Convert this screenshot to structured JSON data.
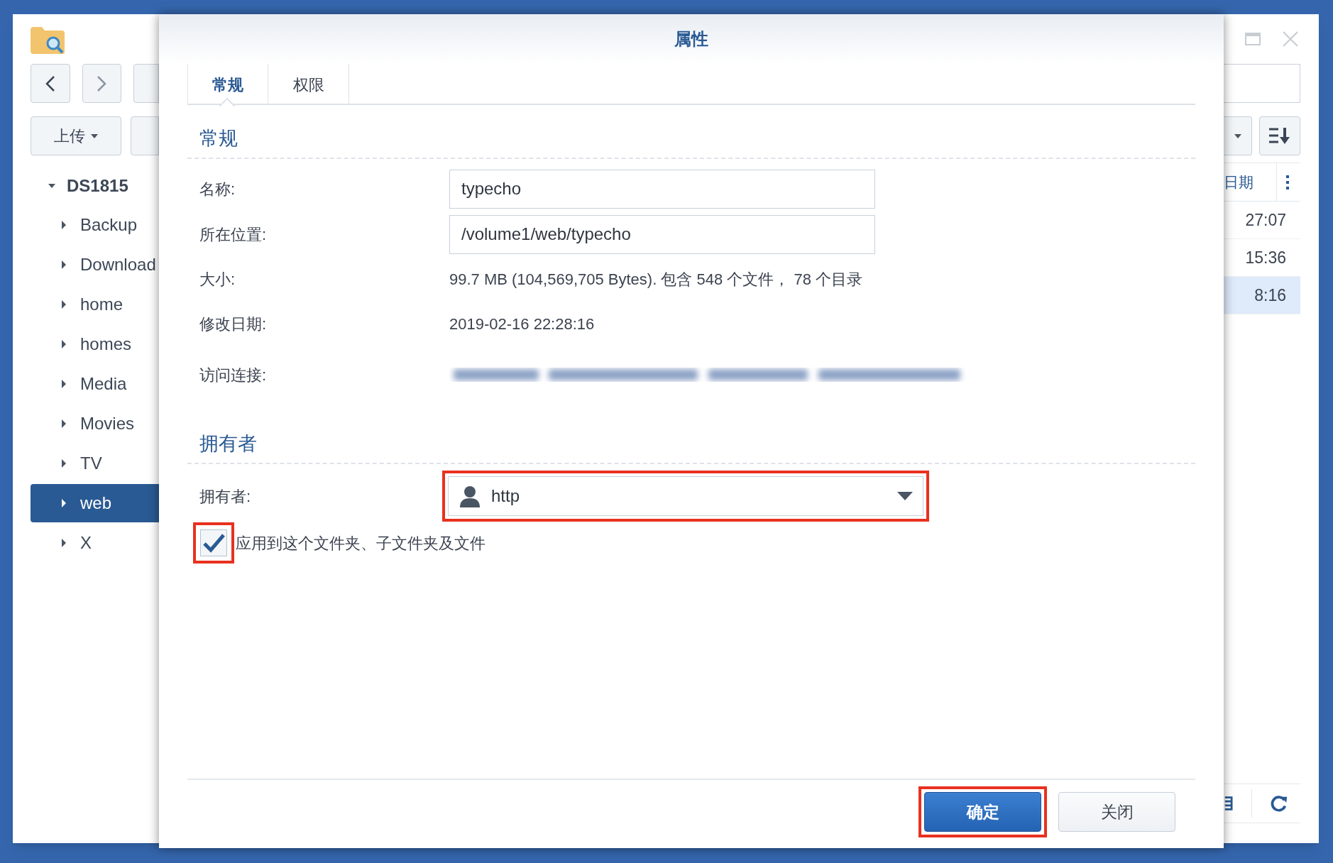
{
  "background_window": {
    "upload_button": "上传",
    "tree": {
      "label": "DS1815",
      "expanded": true,
      "children": [
        {
          "label": "Backup",
          "selected": false
        },
        {
          "label": "Download",
          "selected": false
        },
        {
          "label": "home",
          "selected": false
        },
        {
          "label": "homes",
          "selected": false
        },
        {
          "label": "Media",
          "selected": false
        },
        {
          "label": "Movies",
          "selected": false
        },
        {
          "label": "TV",
          "selected": false
        },
        {
          "label": "web",
          "selected": true
        },
        {
          "label": "X",
          "selected": false
        }
      ]
    },
    "column_header": "日期",
    "rows": [
      {
        "column_1": "27:07",
        "selected": false
      },
      {
        "column_1": "15:36",
        "selected": false
      },
      {
        "column_1": "8:16",
        "selected": true
      }
    ]
  },
  "dialog": {
    "title": "属性",
    "tabs": [
      {
        "label": "常规",
        "selected": true
      },
      {
        "label": "权限",
        "selected": false
      }
    ],
    "general_section": {
      "heading": "常规",
      "fields": [
        {
          "kind": "input",
          "label": "名称:",
          "value": "typecho"
        },
        {
          "kind": "input",
          "label": "所在位置:",
          "value": "/volume1/web/typecho"
        },
        {
          "kind": "text",
          "label": "大小:",
          "value": "99.7 MB (104,569,705 Bytes). 包含 548 个文件， 78 个目录"
        },
        {
          "kind": "text",
          "label": "修改日期:",
          "value": "2019-02-16 22:28:16"
        },
        {
          "kind": "blurred",
          "label": "访问连接:"
        }
      ]
    },
    "owner_section": {
      "heading": "拥有者",
      "owner_label": "拥有者:",
      "owner_value": "http",
      "owner_highlighted": true,
      "apply_checkbox": {
        "label": "应用到这个文件夹、子文件夹及文件",
        "checked": true,
        "highlighted": true
      }
    },
    "buttons": [
      {
        "label": "确定",
        "kind": "primary",
        "highlighted": true
      },
      {
        "label": "关闭",
        "kind": "secondary",
        "highlighted": false
      }
    ]
  }
}
